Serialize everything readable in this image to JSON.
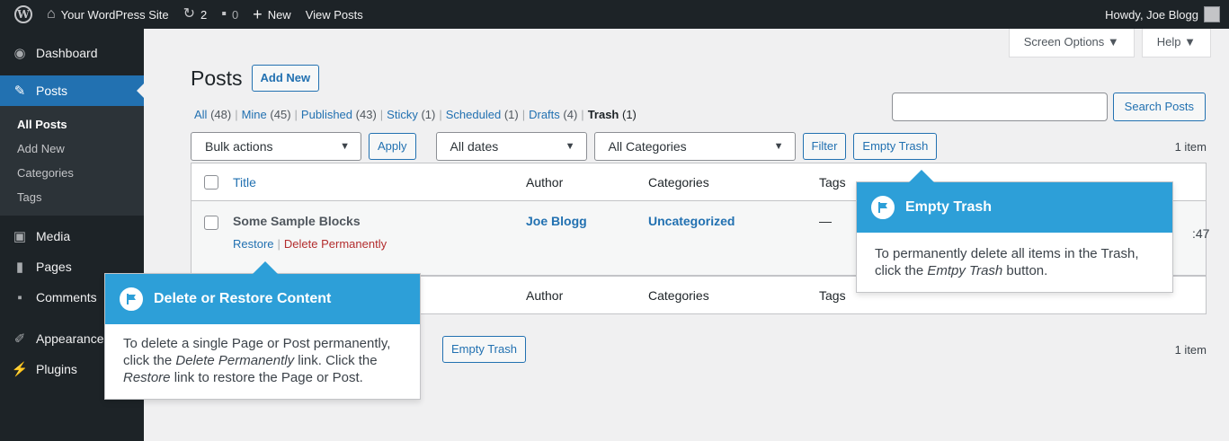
{
  "colors": {
    "admin_bar_bg": "#1d2327",
    "accent": "#2271b1",
    "pointer_header": "#2d9fd8",
    "delete_red": "#b32d2e"
  },
  "admin_bar": {
    "site_name": "Your WordPress Site",
    "updates_count": "2",
    "comments_count": "0",
    "new_label": "New",
    "view_posts_label": "View Posts",
    "greeting": "Howdy, Joe Blogg"
  },
  "sidebar": {
    "dashboard": "Dashboard",
    "posts": "Posts",
    "submenu": [
      "All Posts",
      "Add New",
      "Categories",
      "Tags"
    ],
    "media": "Media",
    "pages": "Pages",
    "comments": "Comments",
    "appearance": "Appearance",
    "plugins": "Plugins"
  },
  "screen_options": {
    "screen_options_label": "Screen Options ▼",
    "help_label": "Help ▼"
  },
  "header": {
    "title": "Posts",
    "add_new_label": "Add New"
  },
  "filters": {
    "all": "All",
    "all_count": "(48)",
    "mine": "Mine",
    "mine_count": "(45)",
    "published": "Published",
    "published_count": "(43)",
    "sticky": "Sticky",
    "sticky_count": "(1)",
    "scheduled": "Scheduled",
    "scheduled_count": "(1)",
    "drafts": "Drafts",
    "drafts_count": "(4)",
    "trash": "Trash",
    "trash_count": "(1)"
  },
  "search": {
    "value": "",
    "button_label": "Search Posts"
  },
  "tablenav_top": {
    "bulk_actions": "Bulk actions",
    "apply_label": "Apply",
    "dates": "All dates",
    "categories": "All Categories",
    "filter_label": "Filter",
    "empty_trash_label": "Empty Trash",
    "item_count": "1 item"
  },
  "table": {
    "columns": {
      "title": "Title",
      "author": "Author",
      "categories": "Categories",
      "tags": "Tags"
    },
    "rows": [
      {
        "title": "Some Sample Blocks",
        "author": "Joe Blogg",
        "categories": "Uncategorized",
        "tags": "—",
        "date_fragment": ":47",
        "restore_label": "Restore",
        "delete_label": "Delete Permanently"
      }
    ]
  },
  "tablenav_bottom": {
    "empty_trash_label": "Empty Trash",
    "item_count": "1 item"
  },
  "pointers": {
    "delete_restore": {
      "title": "Delete or Restore Content",
      "body_1": "To delete a single Page or Post permanently, click the ",
      "body_em1": "Delete Permanently",
      "body_2": " link. Click the ",
      "body_em2": "Restore",
      "body_3": " link to restore the Page or Post."
    },
    "empty_trash": {
      "title": "Empty Trash",
      "body_1": "To permanently delete all items in the Trash, click the ",
      "body_em": "Emtpy Trash",
      "body_2": " button."
    }
  }
}
